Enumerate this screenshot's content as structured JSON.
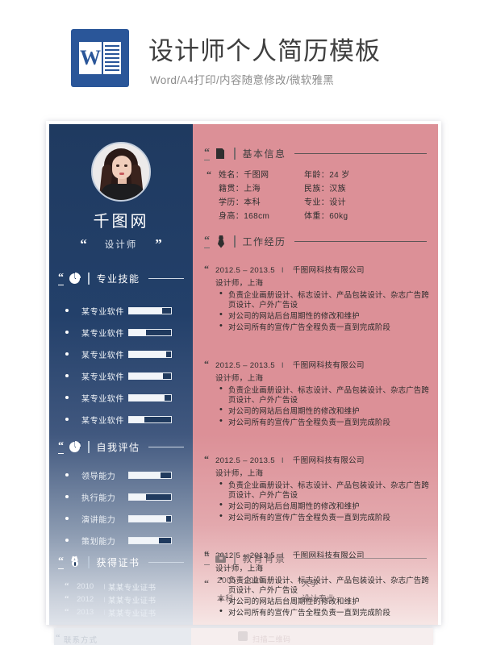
{
  "header": {
    "logo_letter": "W",
    "title": "设计师个人简历模板",
    "subtitle": "Word/A4打印/内容随意修改/微软雅黑"
  },
  "resume": {
    "left": {
      "name": "千图网",
      "role": "设计师",
      "quote_open": "“",
      "quote_close": "”",
      "sections": {
        "skills": {
          "label": "专业技能",
          "icon": "pie-chart-icon",
          "items": [
            {
              "name": "某专业软件",
              "value": 78
            },
            {
              "name": "某专业软件",
              "value": 40
            },
            {
              "name": "某专业软件",
              "value": 88
            },
            {
              "name": "某专业软件",
              "value": 80
            },
            {
              "name": "某专业软件",
              "value": 85
            },
            {
              "name": "某专业软件",
              "value": 37
            }
          ]
        },
        "self_eval": {
          "label": "自我评估",
          "icon": "pie-chart-icon",
          "items": [
            {
              "name": "领导能力",
              "value": 75
            },
            {
              "name": "执行能力",
              "value": 40
            },
            {
              "name": "演讲能力",
              "value": 88
            },
            {
              "name": "策划能力",
              "value": 72
            }
          ]
        },
        "certificates": {
          "label": "获得证书",
          "icon": "medal-icon",
          "separator": "I",
          "items": [
            {
              "year": "2010",
              "title": "某某专业证书"
            },
            {
              "year": "2012",
              "title": "某某专业证书"
            },
            {
              "year": "2013",
              "title": "某某专业证书"
            }
          ]
        }
      }
    },
    "right": {
      "sections": {
        "basic_info": {
          "label": "基本信息",
          "icon": "document-icon",
          "fields": [
            {
              "label": "姓名：千图网",
              "label2": "年龄：24 岁"
            },
            {
              "label": "籍贯：上海",
              "label2": "民族：汉族"
            },
            {
              "label": "学历：本科",
              "label2": "专业：设计"
            },
            {
              "label": "身高：168cm",
              "label2": "体重：60kg"
            }
          ]
        },
        "work": {
          "label": "工作经历",
          "icon": "necktie-icon",
          "entries": [
            {
              "period": "2012.5 – 2013.5",
              "separator": "I",
              "company": "千图网科技有限公司",
              "role_city": "设计师，上海",
              "bullets": [
                "负责企业画册设计、标志设计、产品包装设计、杂志广告跨页设计、户外广告设",
                "对公司的网站后台周期性的修改和维护",
                "对公司所有的宣传广告全程负责一直到完成阶段"
              ]
            },
            {
              "period": "2012.5 – 2013.5",
              "separator": "I",
              "company": "千图网科技有限公司",
              "role_city": "设计师，上海",
              "bullets": [
                "负责企业画册设计、标志设计、产品包装设计、杂志广告跨页设计、户外广告设",
                "对公司的网站后台周期性的修改和维护",
                "对公司所有的宣传广告全程负责一直到完成阶段"
              ]
            },
            {
              "period": "2012.5 – 2013.5",
              "separator": "I",
              "company": "千图网科技有限公司",
              "role_city": "设计师，上海",
              "bullets": [
                "负责企业画册设计、标志设计、产品包装设计、杂志广告跨页设计、户外广告设",
                "对公司的网站后台周期性的修改和维护",
                "对公司所有的宣传广告全程负责一直到完成阶段"
              ]
            },
            {
              "period": "2012.5 – 2013.5",
              "separator": "I",
              "company": "千图网科技有限公司",
              "role_city": "设计师，上海",
              "bullets": [
                "负责企业画册设计、标志设计、产品包装设计、杂志广告跨页设计、户外广告设",
                "对公司的网站后台周期性的修改和维护",
                "对公司所有的宣传广告全程负责一直到完成阶段"
              ]
            }
          ]
        },
        "education": {
          "label": "教育背景",
          "icon": "briefcase-icon",
          "entries": [
            {
              "period": "2005 - 2009",
              "separator": "I",
              "school": "大学",
              "degree": "本科",
              "major": "设计专业"
            }
          ]
        }
      }
    }
  },
  "next_page_peek": {
    "contact_label": "联系方式",
    "qr_label": "扫描二维码"
  },
  "colors": {
    "navy": "#1f3a60",
    "rose": "#dc9097",
    "word_blue": "#2a5699"
  }
}
